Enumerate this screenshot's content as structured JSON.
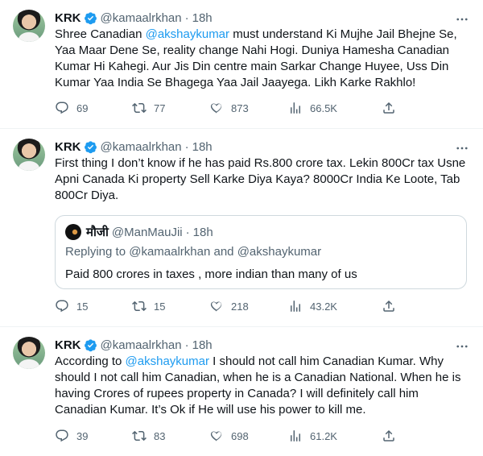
{
  "tweets": [
    {
      "author": {
        "name": "KRK",
        "handle": "@kamaalrkhan",
        "time": "18h"
      },
      "text_before": "Shree Canadian ",
      "mention": "@akshaykumar",
      "text_after": " must understand Ki Mujhe Jail Bhejne Se, Yaa Maar Dene Se, reality change Nahi Hogi. Duniya Hamesha Canadian Kumar Hi Kahegi. Aur Jis Din centre main Sarkar Change Huyee, Uss Din Kumar Yaa India Se Bhagega Yaa Jail Jaayega. Likh Karke Rakhlo!",
      "stats": {
        "replies": "69",
        "retweets": "77",
        "likes": "873",
        "views": "66.5K"
      }
    },
    {
      "author": {
        "name": "KRK",
        "handle": "@kamaalrkhan",
        "time": "18h"
      },
      "text": "First thing I don’t know if he has paid Rs.800 crore tax. Lekin 800Cr tax Usne Apni Canada Ki property Sell Karke Diya Kaya? 8000Cr India Ke Loote, Tab 800Cr Diya.",
      "quote": {
        "name": "मौजी",
        "handle": "@ManMauJii",
        "time": "18h",
        "replying_prefix": "Replying to ",
        "replying_to_1": "@kamaalrkhan",
        "replying_and": " and ",
        "replying_to_2": "@akshaykumar",
        "text": "Paid 800 crores in taxes , more indian than many of us"
      },
      "stats": {
        "replies": "15",
        "retweets": "15",
        "likes": "218",
        "views": "43.2K"
      }
    },
    {
      "author": {
        "name": "KRK",
        "handle": "@kamaalrkhan",
        "time": "18h"
      },
      "text_before": "According to ",
      "mention": "@akshaykumar",
      "text_after": " I should not call him Canadian Kumar. Why should I not call him Canadian, when he is a Canadian National. When he is having Crores of rupees property in Canada? I will definitely call him Canadian Kumar. It’s Ok if He will use his power to kill me.",
      "stats": {
        "replies": "39",
        "retweets": "83",
        "likes": "698",
        "views": "61.2K"
      }
    }
  ],
  "ui": {
    "dot": "·",
    "more": "⋯"
  },
  "colors": {
    "accent": "#1d9bf0",
    "muted": "#536471",
    "border": "#eff3f4"
  }
}
